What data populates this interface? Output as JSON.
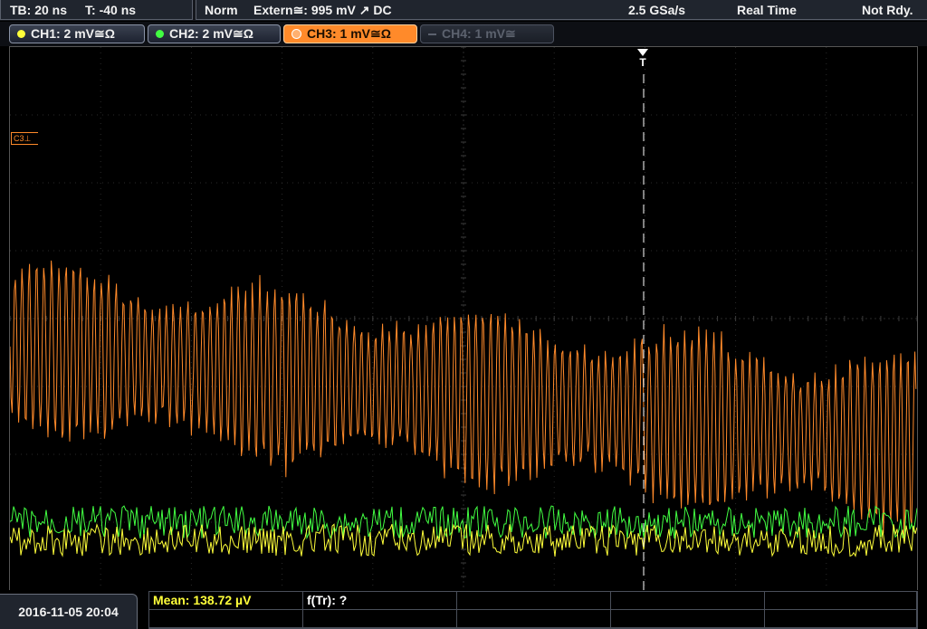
{
  "topbar": {
    "timebase": "TB: 20 ns",
    "trigger_time": "T: -40 ns",
    "acq_mode": "Norm",
    "trigger_source": "Extern≅: 995 mV ↗ DC",
    "sample_rate": "2.5 GSa/s",
    "mode": "Real Time",
    "status": "Not Rdy."
  },
  "channels": [
    {
      "label": "CH1: 2 mV≅Ω",
      "color": "#ffff3a",
      "state": "on"
    },
    {
      "label": "CH2: 2 mV≅Ω",
      "color": "#42ff42",
      "state": "on"
    },
    {
      "label": "CH3: 1 mV≅Ω",
      "color": "#ff8a2a",
      "state": "selected"
    },
    {
      "label": "CH4: 1 mV≅",
      "color": "#5c626e",
      "state": "off"
    }
  ],
  "screen": {
    "ch3_marker": "C3⊥",
    "trigger_marker": "T"
  },
  "bottom": {
    "datetime": "2016-11-05 20:04",
    "measurements": [
      {
        "label": "Mean: 138.72 µV",
        "color": "#ffff3a"
      },
      {
        "label": "f(Tr): ?",
        "color": "#ffffff"
      }
    ]
  },
  "traces": {
    "ch3_color": "#ff8a2a",
    "ch2_color": "#42ff42",
    "ch1_color": "#ffff3a"
  }
}
